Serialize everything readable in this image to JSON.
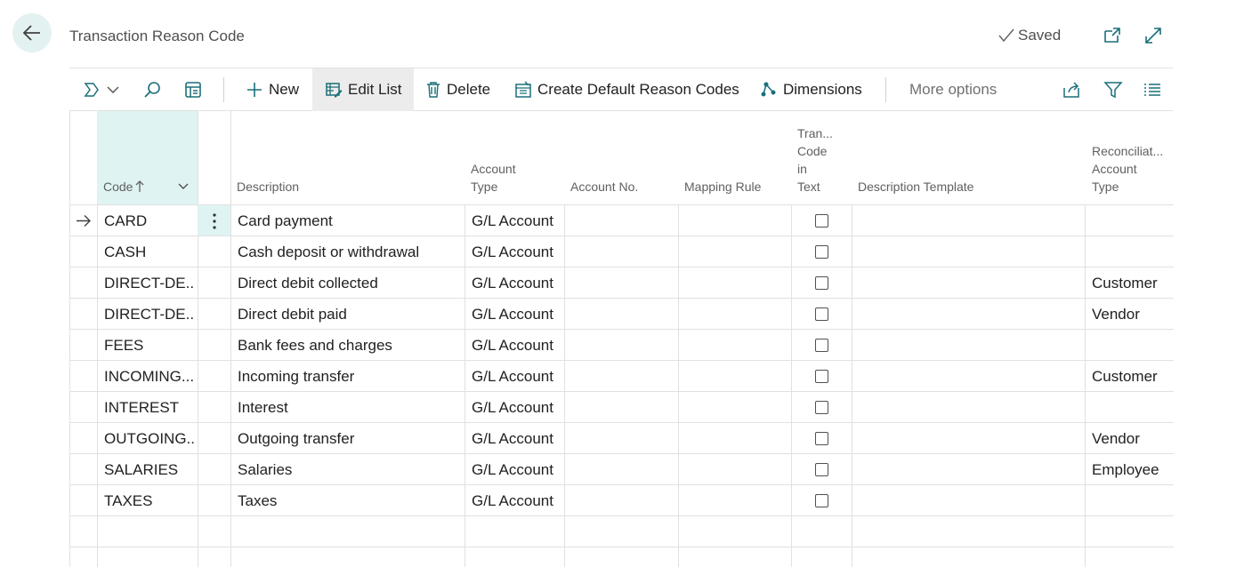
{
  "header": {
    "title": "Transaction Reason Code",
    "status": "Saved"
  },
  "toolbar": {
    "new_label": "New",
    "edit_list_label": "Edit List",
    "delete_label": "Delete",
    "create_default_label": "Create Default Reason Codes",
    "dimensions_label": "Dimensions",
    "more_options_label": "More options"
  },
  "columns": {
    "code": "Code",
    "description": "Description",
    "account_type_1": "Account",
    "account_type_2": "Type",
    "account_no": "Account No.",
    "mapping_rule": "Mapping Rule",
    "tran_1": "Tran...",
    "tran_2": "Code",
    "tran_3": "in",
    "tran_4": "Text",
    "description_template": "Description Template",
    "recon_1": "Reconciliat...",
    "recon_2": "Account",
    "recon_3": "Type"
  },
  "rows": [
    {
      "code": "CARD",
      "description": "Card payment",
      "account_type": "G/L Account",
      "recon_type": ""
    },
    {
      "code": "CASH",
      "description": "Cash deposit or withdrawal",
      "account_type": "G/L Account",
      "recon_type": ""
    },
    {
      "code": "DIRECT-DE...",
      "description": "Direct debit collected",
      "account_type": "G/L Account",
      "recon_type": "Customer"
    },
    {
      "code": "DIRECT-DE...",
      "description": "Direct debit paid",
      "account_type": "G/L Account",
      "recon_type": "Vendor"
    },
    {
      "code": "FEES",
      "description": "Bank fees and charges",
      "account_type": "G/L Account",
      "recon_type": ""
    },
    {
      "code": "INCOMING...",
      "description": "Incoming transfer",
      "account_type": "G/L Account",
      "recon_type": "Customer"
    },
    {
      "code": "INTEREST",
      "description": "Interest",
      "account_type": "G/L Account",
      "recon_type": ""
    },
    {
      "code": "OUTGOING...",
      "description": "Outgoing transfer",
      "account_type": "G/L Account",
      "recon_type": "Vendor"
    },
    {
      "code": "SALARIES",
      "description": "Salaries",
      "account_type": "G/L Account",
      "recon_type": "Employee"
    },
    {
      "code": "TAXES",
      "description": "Taxes",
      "account_type": "G/L Account",
      "recon_type": ""
    }
  ],
  "colors": {
    "accent": "#dff3f3",
    "back_button": "#e3f1f1",
    "icon": "#1a6f7a"
  }
}
